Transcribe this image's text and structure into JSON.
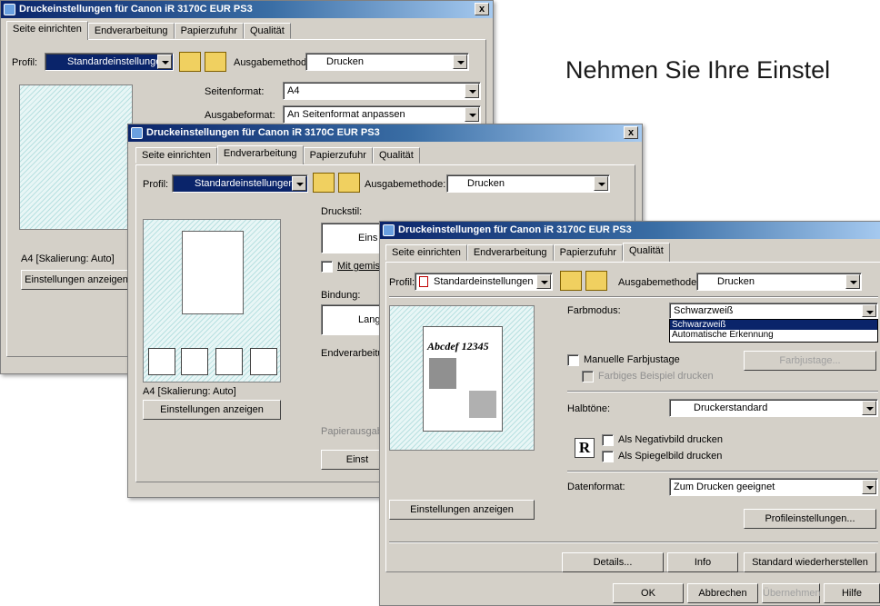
{
  "heading": "Nehmen Sie Ihre Einstel",
  "window_title": "Druckeinstellungen für Canon iR 3170C EUR PS3",
  "close_glyph": "x",
  "tabs": [
    "Seite einrichten",
    "Endverarbeitung",
    "Papierzufuhr",
    "Qualität"
  ],
  "profile": {
    "label": "Profil:",
    "value": "Standardeinstellungen"
  },
  "output": {
    "label": "Ausgabemethode:",
    "value": "Drucken"
  },
  "win1": {
    "page_size_label": "Seitenformat:",
    "page_size_value": "A4",
    "output_size_label": "Ausgabeformat:",
    "output_size_value": "An Seitenformat anpassen",
    "scale_text": "A4 [Skalierung: Auto]",
    "show_settings": "Einstellungen anzeigen"
  },
  "win2": {
    "print_style_label": "Druckstil:",
    "print_style_value": "Eins",
    "mixed_label": "Mit gemisc",
    "binding_label": "Bindung:",
    "binding_value": "Lang",
    "finishing_label": "Endverarbeitu",
    "paper_output_label": "Papierausgab",
    "scale_text": "A4 [Skalierung: Auto]",
    "show_settings": "Einstellungen anzeigen",
    "bottom_btn": "Einst"
  },
  "win3": {
    "preview_sample": "Abcdef 12345",
    "color_mode_label": "Farbmodus:",
    "color_mode_value": "Schwarzweiß",
    "color_mode_options": [
      "Schwarzweiß",
      "Automatische Erkennung"
    ],
    "manual_color": "Manuelle Farbjustage",
    "color_adjust_btn": "Farbjustage...",
    "color_sample": "Farbiges Beispiel drucken",
    "halftones_label": "Halbtöne:",
    "halftones_value": "Druckerstandard",
    "negative": "Als Negativbild drucken",
    "mirror": "Als Spiegelbild drucken",
    "r_glyph": "R",
    "data_format_label": "Datenformat:",
    "data_format_value": "Zum Drucken geeignet",
    "show_settings": "Einstellungen anzeigen",
    "profile_settings": "Profileinstellungen...",
    "details": "Details...",
    "info": "Info",
    "restore": "Standard wiederherstellen",
    "ok": "OK",
    "cancel": "Abbrechen",
    "apply": "Übernehmen",
    "help": "Hilfe"
  },
  "colors": {
    "title_start": "#0a246a",
    "title_end": "#a6caf0",
    "dialog_bg": "#d4d0c8",
    "select_bg": "#0a246a"
  }
}
